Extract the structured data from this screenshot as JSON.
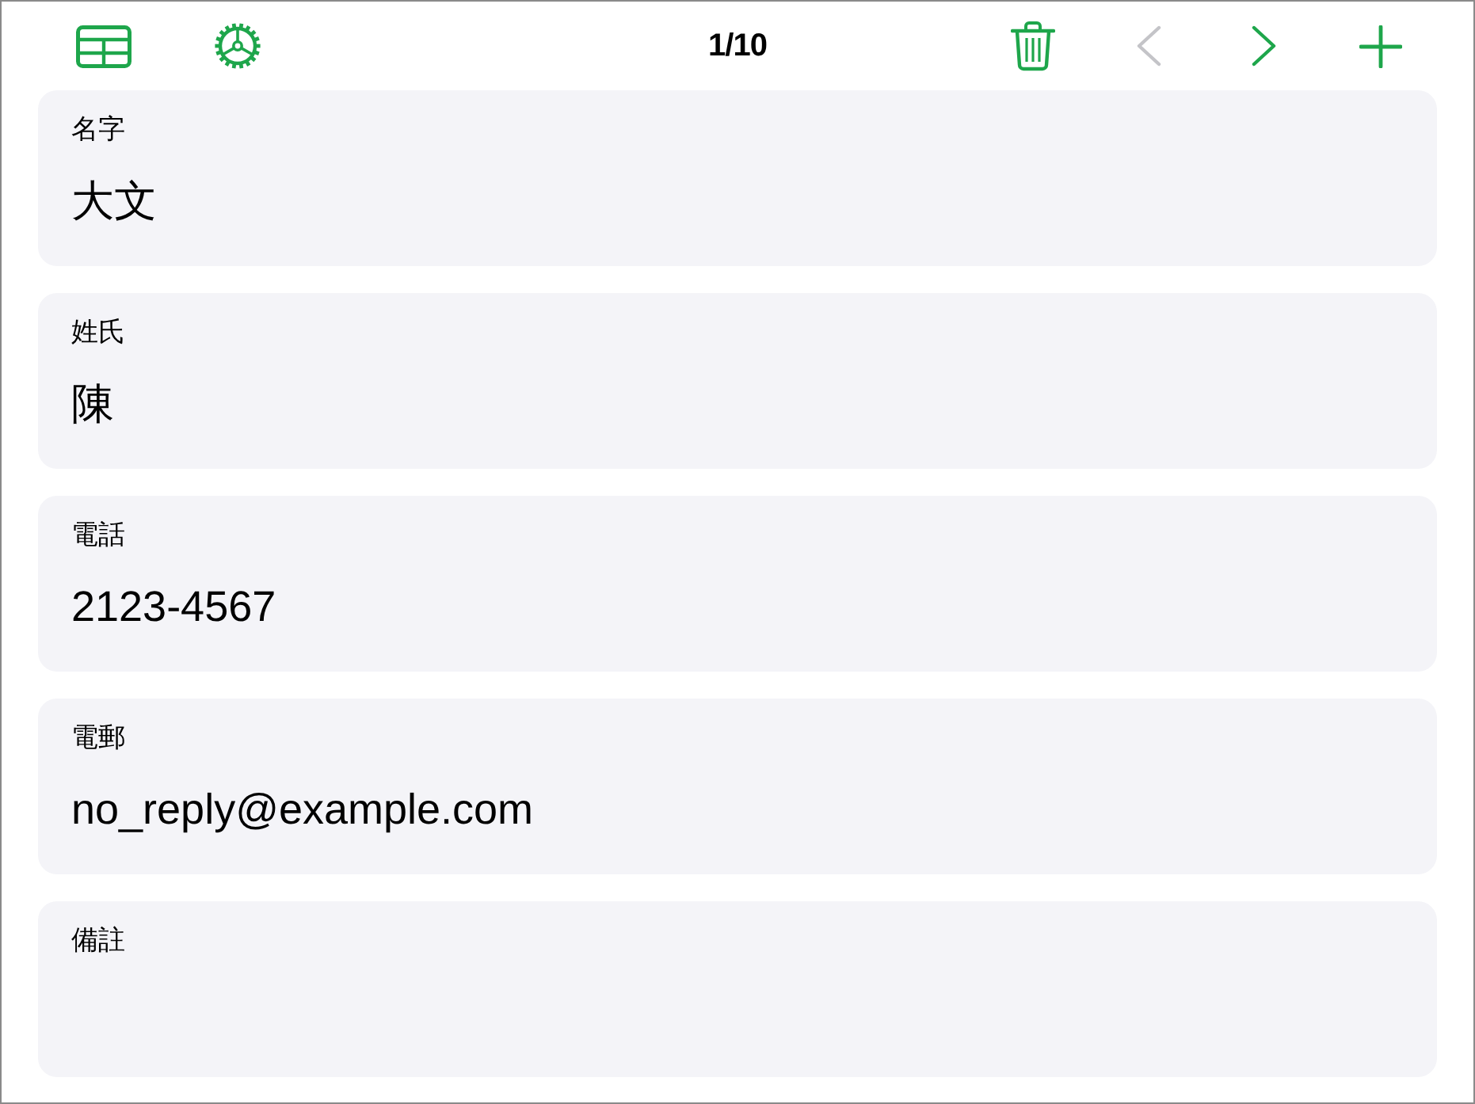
{
  "toolbar": {
    "left": [
      {
        "kind": "table",
        "disabled": false
      },
      {
        "kind": "gear",
        "disabled": false
      }
    ],
    "title": "1/10",
    "right": [
      {
        "kind": "trash",
        "disabled": false
      },
      {
        "kind": "back",
        "disabled": true
      },
      {
        "kind": "forward",
        "disabled": false
      },
      {
        "kind": "add",
        "disabled": false
      }
    ]
  },
  "fields": [
    {
      "label": "名字",
      "value": "大文"
    },
    {
      "label": "姓氏",
      "value": "陳"
    },
    {
      "label": "電話",
      "value": "2123-4567"
    },
    {
      "label": "電郵",
      "value": "no_reply@example.com"
    },
    {
      "label": "備註"
    }
  ]
}
